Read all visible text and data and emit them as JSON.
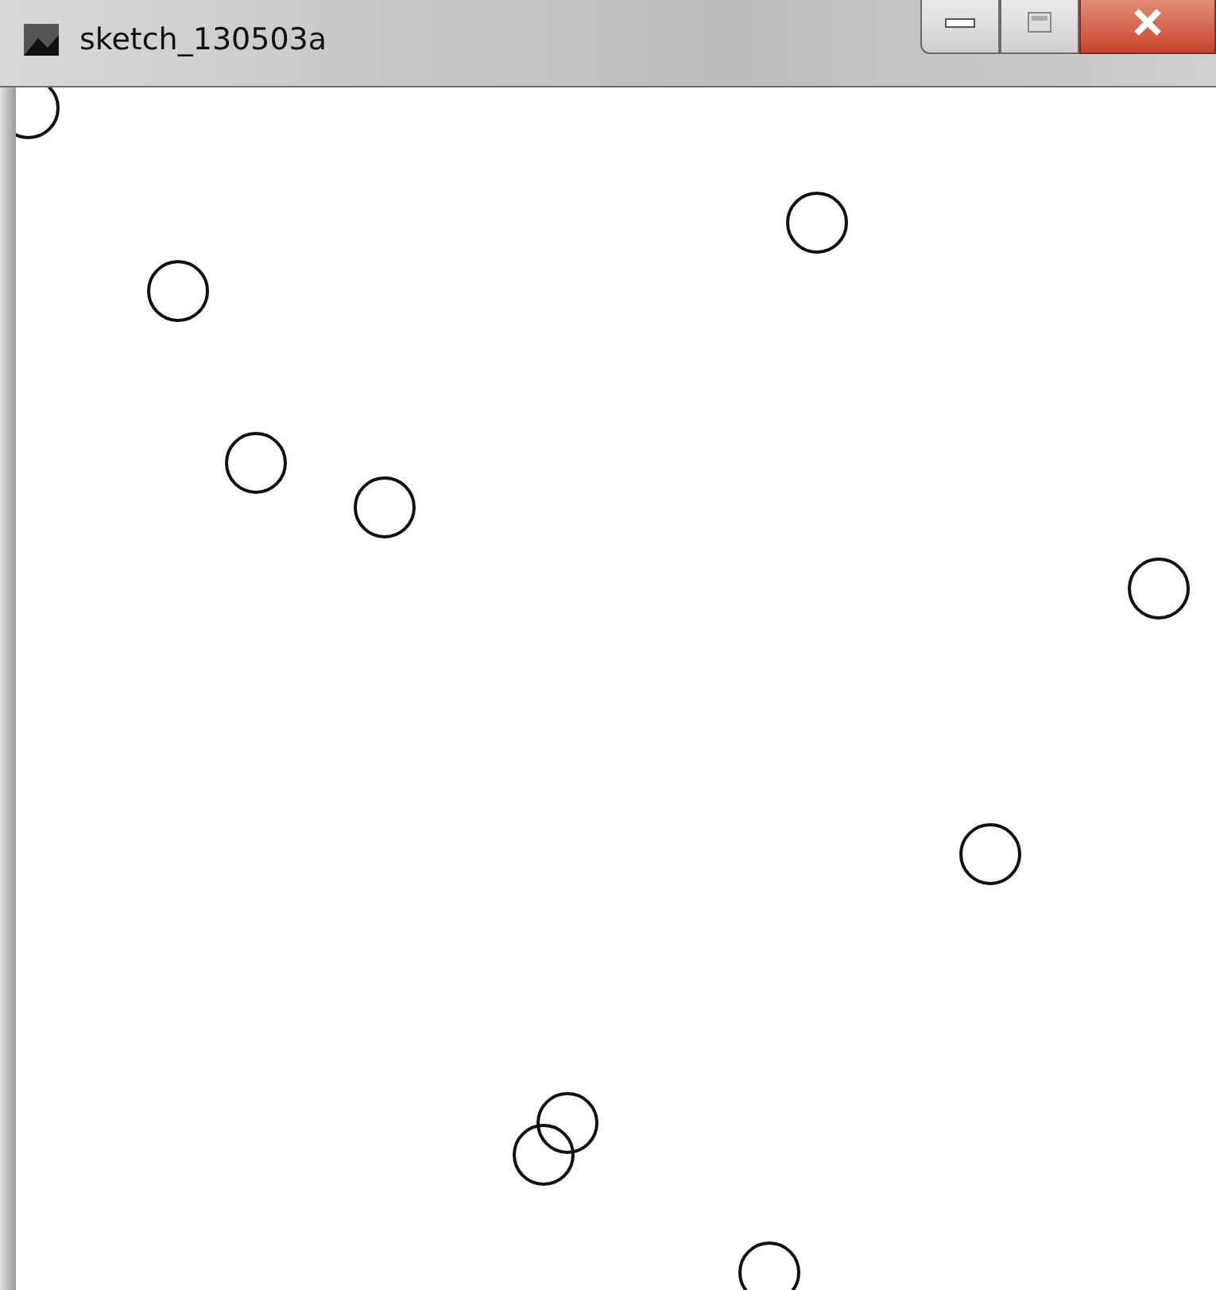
{
  "window": {
    "title": "sketch_130503a"
  }
}
